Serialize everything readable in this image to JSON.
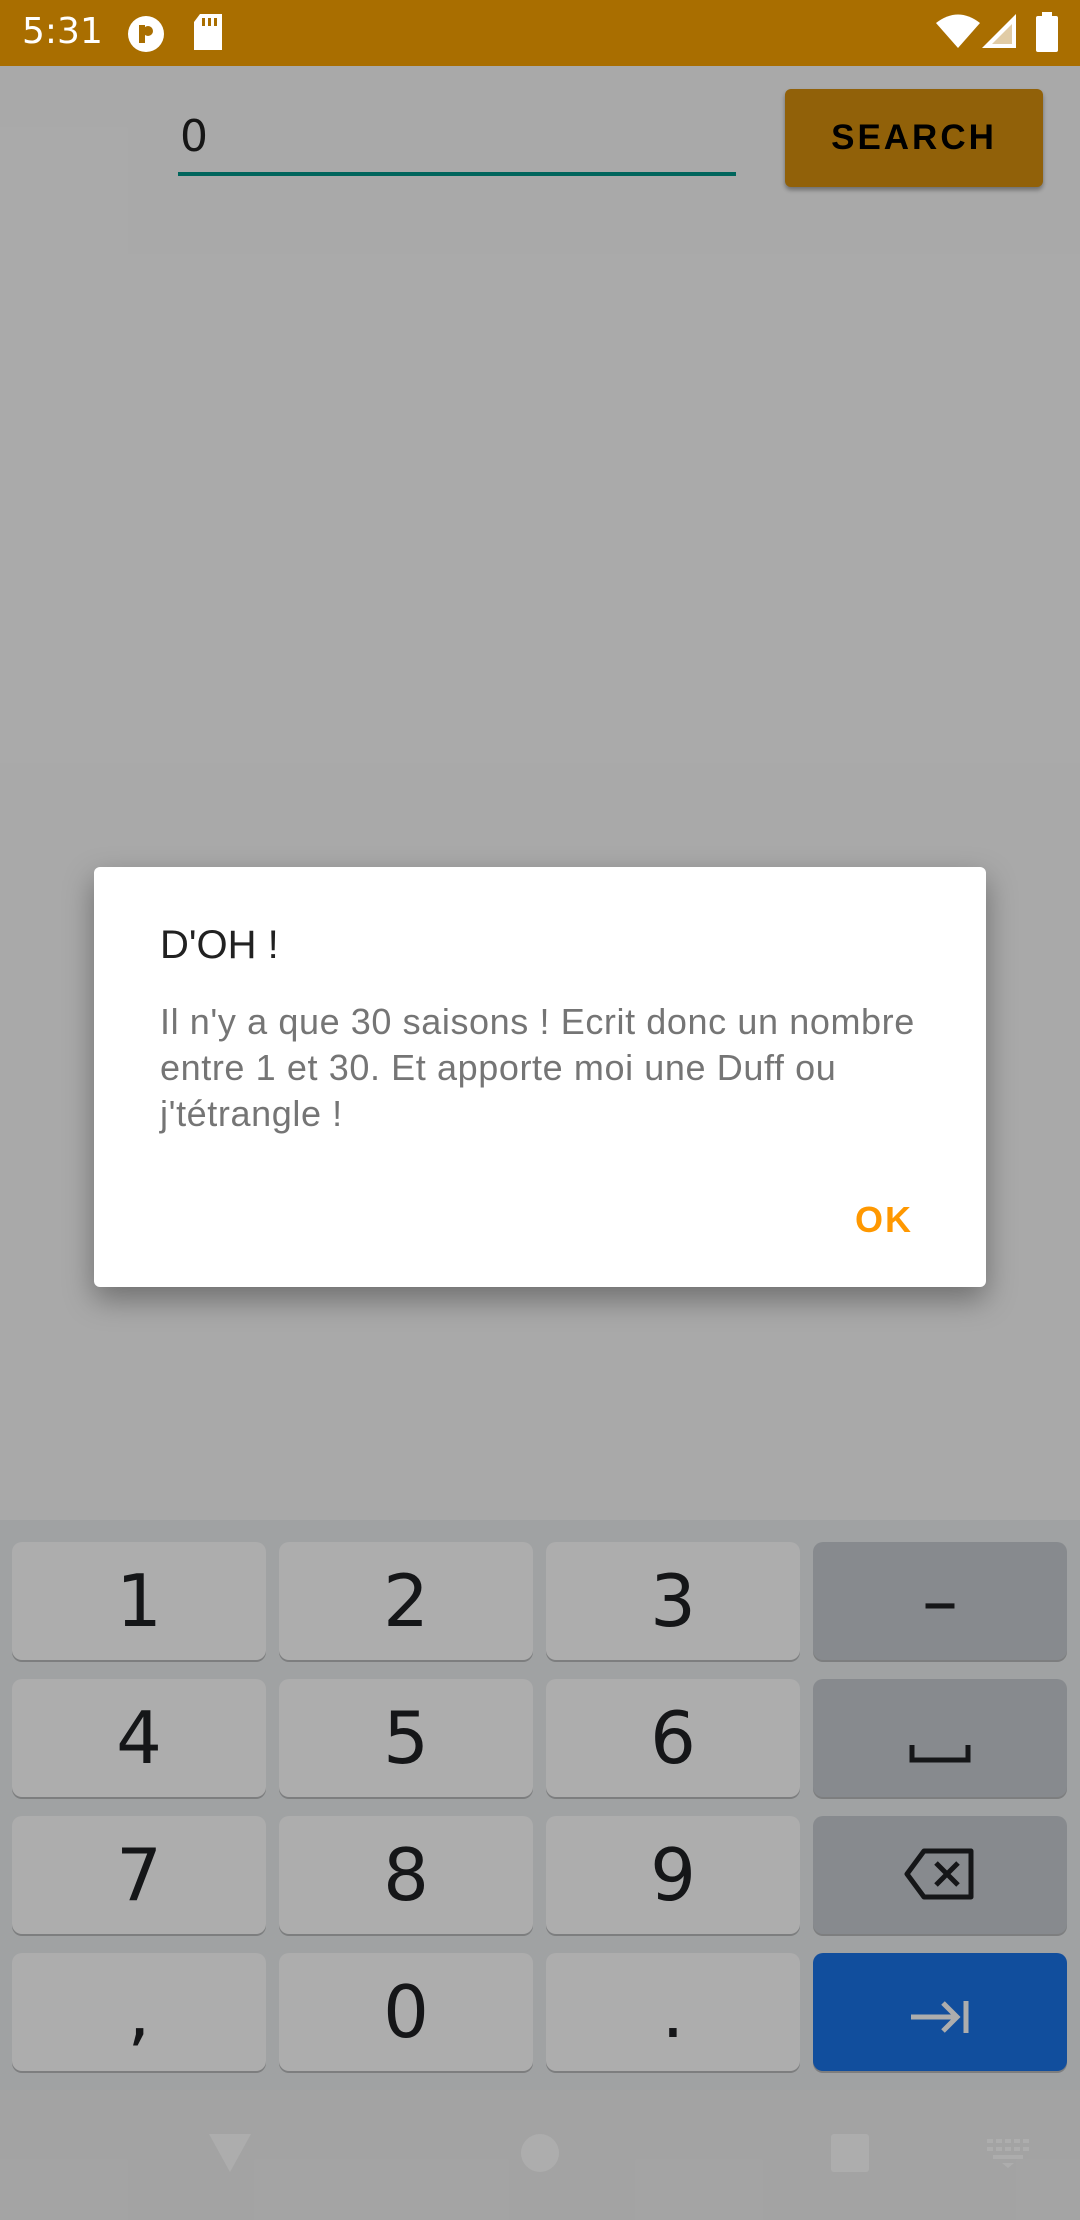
{
  "status_bar": {
    "time": "5:31",
    "background_color": "#a96e00",
    "icons_left": [
      "pocketcasts-icon",
      "sd-card-icon"
    ],
    "icons_right": [
      "wifi-icon",
      "signal-icon",
      "battery-icon"
    ]
  },
  "search": {
    "value": "0",
    "button_label": "SEARCH",
    "button_color": "#d68f0e",
    "underline_color": "#009688"
  },
  "dialog": {
    "title": "D'OH !",
    "message": "Il n'y a que 30 saisons ! Ecrit donc un nombre entre 1 et 30. Et apporte moi une Duff ou j'tétrangle !",
    "ok_label": "OK",
    "ok_color": "#ff9800"
  },
  "keyboard": {
    "rows": [
      [
        "1",
        "2",
        "3",
        "–"
      ],
      [
        "4",
        "5",
        "6",
        "space"
      ],
      [
        "7",
        "8",
        "9",
        "backspace"
      ],
      [
        ",",
        "0",
        ".",
        "next"
      ]
    ],
    "labels": {
      "k1": "1",
      "k2": "2",
      "k3": "3",
      "minus": "–",
      "k4": "4",
      "k5": "5",
      "k6": "6",
      "k7": "7",
      "k8": "8",
      "k9": "9",
      "comma": ",",
      "k0": "0",
      "period": "."
    },
    "action_color": "#1a73e8"
  },
  "nav_bar": {
    "buttons": [
      "back-icon",
      "home-icon",
      "recents-icon",
      "keyboard-switch-icon"
    ]
  }
}
